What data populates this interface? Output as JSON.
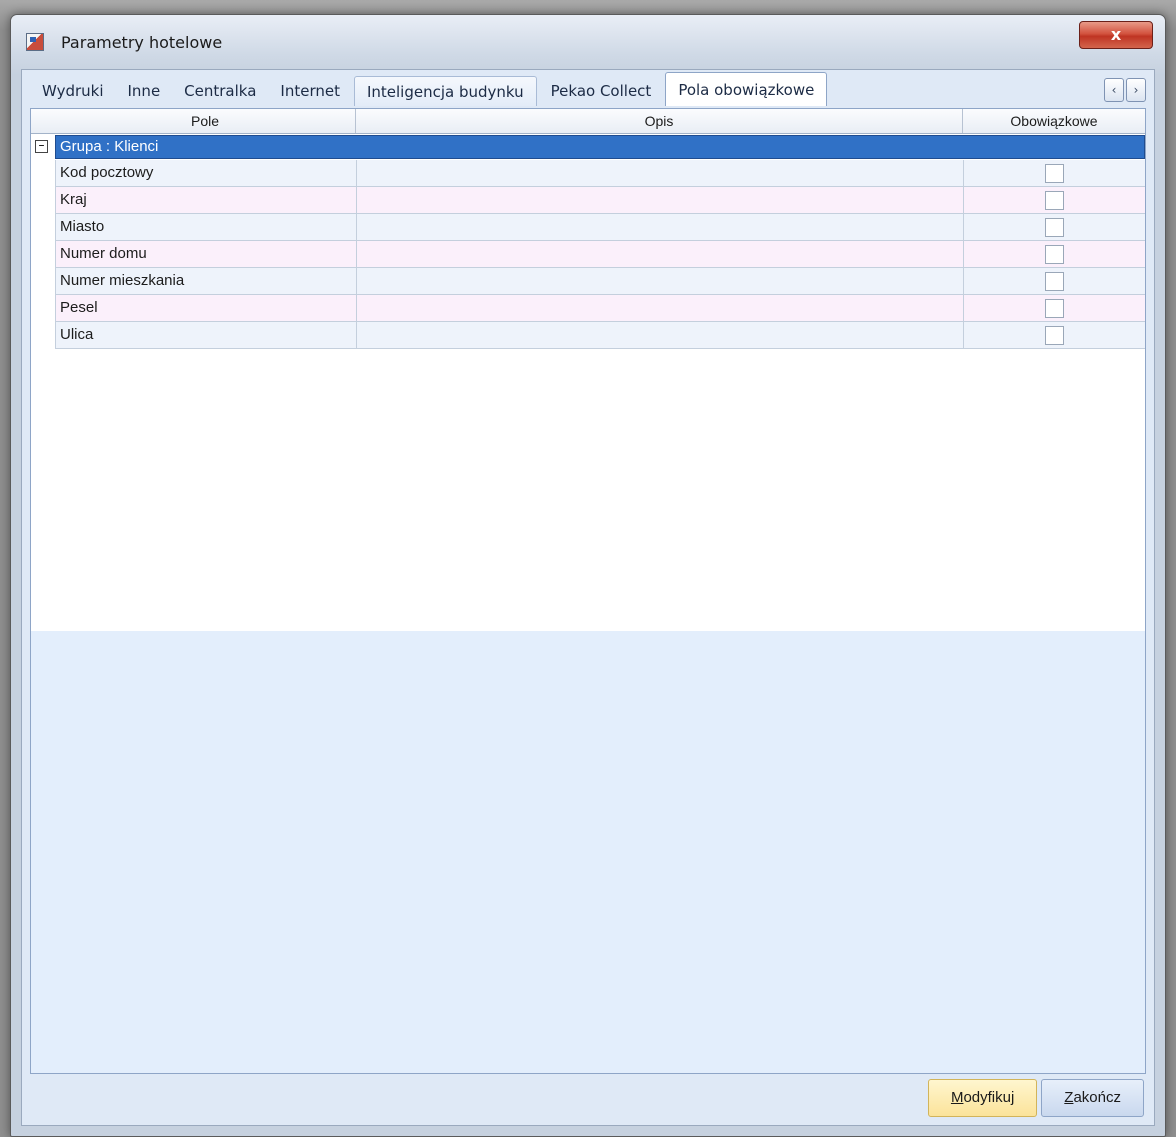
{
  "window": {
    "title": "Parametry hotelowe",
    "close_label": "x"
  },
  "tabs": [
    {
      "label": "Wydruki",
      "style": "plain"
    },
    {
      "label": "Inne",
      "style": "plain"
    },
    {
      "label": "Centralka",
      "style": "plain"
    },
    {
      "label": "Internet",
      "style": "plain"
    },
    {
      "label": "Inteligencja budynku",
      "style": "boxed"
    },
    {
      "label": "Pekao Collect",
      "style": "plain"
    },
    {
      "label": "Pola obowiązkowe",
      "style": "active"
    }
  ],
  "tab_scroll": {
    "left": "‹",
    "right": "›"
  },
  "grid": {
    "columns": [
      "Pole",
      "Opis",
      "Obowiązkowe"
    ],
    "group": {
      "toggle": "–",
      "label": "Grupa : Klienci"
    },
    "rows": [
      {
        "field": "Kod pocztowy",
        "description": "",
        "required": false
      },
      {
        "field": "Kraj",
        "description": "",
        "required": false
      },
      {
        "field": "Miasto",
        "description": "",
        "required": false
      },
      {
        "field": "Numer domu",
        "description": "",
        "required": false
      },
      {
        "field": "Numer mieszkania",
        "description": "",
        "required": false
      },
      {
        "field": "Pesel",
        "description": "",
        "required": false
      },
      {
        "field": "Ulica",
        "description": "",
        "required": false
      }
    ]
  },
  "buttons": {
    "modify": {
      "mnemonic": "M",
      "rest": "odyfikuj"
    },
    "finish": {
      "mnemonic": "Z",
      "rest": "akończ"
    }
  }
}
